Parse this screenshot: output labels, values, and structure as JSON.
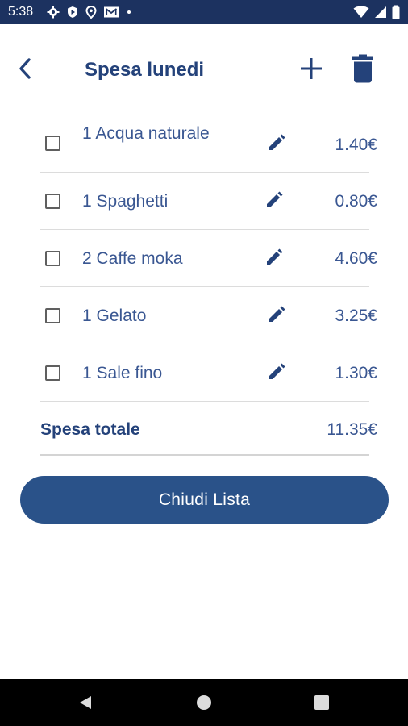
{
  "status_bar": {
    "time": "5:38",
    "left_icons": [
      "gear-icon",
      "shield-play-icon",
      "location-pin-icon",
      "gmail-icon",
      "dot-icon"
    ],
    "right_icons": [
      "wifi-icon",
      "signal-icon",
      "battery-icon"
    ]
  },
  "header": {
    "title": "Spesa lunedi",
    "back_icon": "chevron-left-icon",
    "add_icon": "plus-icon",
    "delete_icon": "trash-icon"
  },
  "items": [
    {
      "label": "1 Acqua naturale",
      "price": "1.40€",
      "checked": false
    },
    {
      "label": "1 Spaghetti",
      "price": "0.80€",
      "checked": false
    },
    {
      "label": "2 Caffe moka",
      "price": "4.60€",
      "checked": false
    },
    {
      "label": "1 Gelato",
      "price": "3.25€",
      "checked": false
    },
    {
      "label": "1 Sale fino",
      "price": "1.30€",
      "checked": false
    }
  ],
  "total": {
    "label": "Spesa totale",
    "value": "11.35€"
  },
  "close_button": {
    "label": "Chiudi Lista"
  },
  "colors": {
    "status_bar": "#1c3260",
    "primary_text": "#24427a",
    "item_text": "#3a5792",
    "button": "#2a5289"
  }
}
